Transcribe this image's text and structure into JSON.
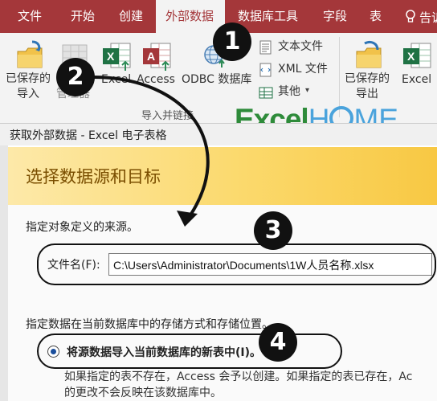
{
  "tabs": [
    {
      "label": "文件",
      "active": false
    },
    {
      "label": "开始",
      "active": false
    },
    {
      "label": "创建",
      "active": false
    },
    {
      "label": "外部数据",
      "active": true
    },
    {
      "label": "数据库工具",
      "active": false
    },
    {
      "label": "字段",
      "active": false
    },
    {
      "label": "表",
      "active": false
    }
  ],
  "tell_me": "告诉",
  "ribbon": {
    "saved_imports": [
      "已保存的",
      "导入"
    ],
    "linked_manager": "管理器",
    "excel": "Excel",
    "access": "Access",
    "odbc": "ODBC 数据库",
    "text_file": "文本文件",
    "xml_file": "XML 文件",
    "more": "其他",
    "group_label": "导入并链接",
    "saved_exports": [
      "已保存的",
      "导出"
    ],
    "excel_export": "Excel"
  },
  "watermark": {
    "part1": "Excel",
    "part2": "H",
    "part3": "ME"
  },
  "dialog": {
    "title": "获取外部数据 - Excel 电子表格",
    "banner": "选择数据源和目标",
    "source_prompt": "指定对象定义的来源。",
    "filename_label": "文件名(F):",
    "filename_value": "C:\\Users\\Administrator\\Documents\\1W人员名称.xlsx",
    "storage_prompt": "指定数据在当前数据库中的存储方式和存储位置。",
    "option_import": "将源数据导入当前数据库的新表中(I)。",
    "option_desc1": "如果指定的表不存在，Access 会予以创建。如果指定的表已存在，Ac",
    "option_desc2": "的更改不会反映在该数据库中。"
  },
  "callouts": [
    "1",
    "2",
    "3",
    "4"
  ],
  "colors": {
    "tabbar": "#a4373a",
    "ribbon": "#f3f3f3",
    "banner": "#fbd96c",
    "excel_green": "#1f7244",
    "access_red": "#a4373a"
  }
}
